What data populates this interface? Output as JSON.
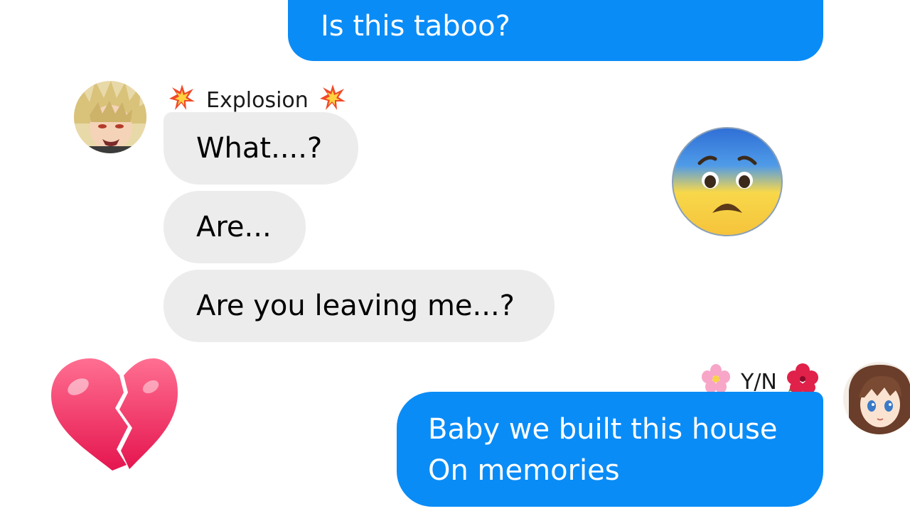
{
  "conversation": {
    "top_outgoing": {
      "lines": [
        "Is this taboo?"
      ]
    },
    "contact": {
      "name": "Explosion",
      "name_emoji_icon": "collision-icon",
      "messages": [
        "What....?",
        "Are...",
        "Are you leaving me...?"
      ]
    },
    "user": {
      "name": "Y/N",
      "left_emoji_icon": "cherry-blossom-icon",
      "right_emoji_icon": "hibiscus-icon",
      "message_lines": [
        "Baby we built this house",
        "On memories"
      ]
    },
    "reactions": {
      "scared_face": "anxious-face-icon",
      "broken_heart": "broken-heart-icon"
    }
  },
  "colors": {
    "outgoing_bubble": "#0a8cf7",
    "incoming_bubble": "#ececec",
    "background": "#ffffff"
  }
}
